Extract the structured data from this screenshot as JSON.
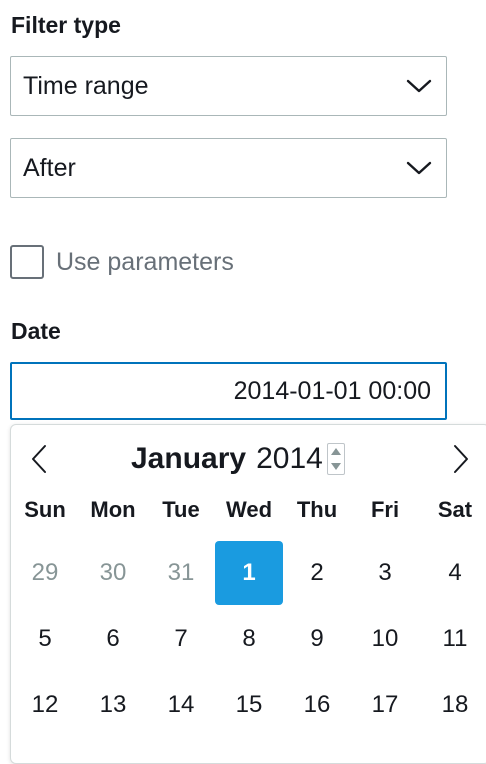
{
  "filter_type": {
    "label": "Filter type",
    "type_select": {
      "value": "Time range"
    },
    "condition_select": {
      "value": "After"
    }
  },
  "use_parameters": {
    "label": "Use parameters",
    "checked": false
  },
  "date": {
    "label": "Date",
    "value": "2014-01-01 00:00"
  },
  "calendar": {
    "month": "January",
    "year": "2014",
    "weekdays": [
      "Sun",
      "Mon",
      "Tue",
      "Wed",
      "Thu",
      "Fri",
      "Sat"
    ],
    "weeks": [
      [
        "29",
        "30",
        "31",
        "1",
        "2",
        "3",
        "4"
      ],
      [
        "5",
        "6",
        "7",
        "8",
        "9",
        "10",
        "11"
      ],
      [
        "12",
        "13",
        "14",
        "15",
        "16",
        "17",
        "18"
      ]
    ],
    "selected_day": "1",
    "accent_color": "#1a9be0",
    "focus_border_color": "#0073bb"
  }
}
